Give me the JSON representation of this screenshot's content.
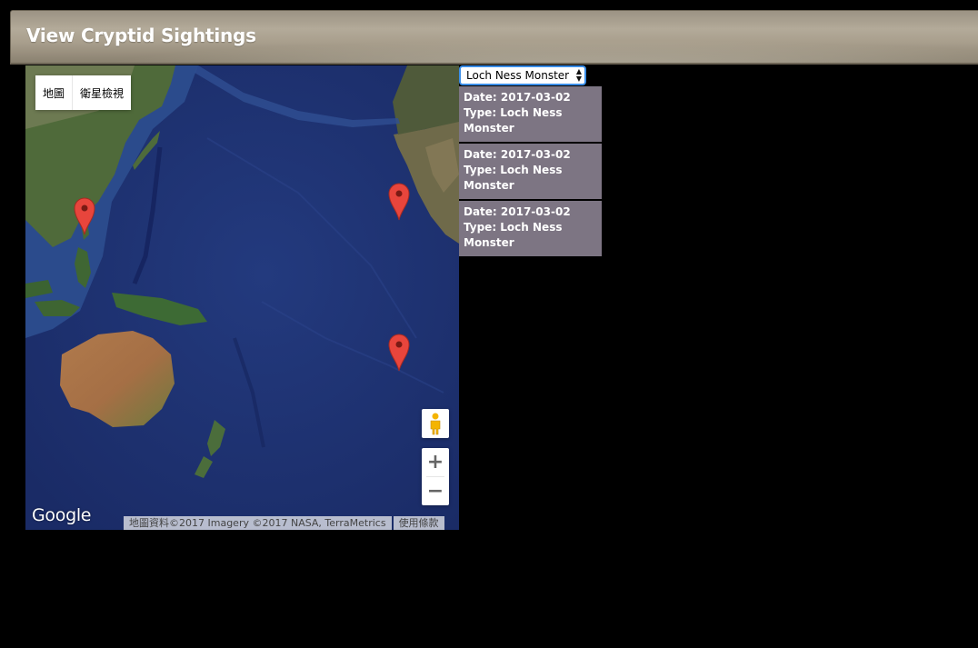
{
  "header": {
    "title": "View Cryptid Sightings"
  },
  "map": {
    "map_type_buttons": [
      "地圖",
      "衛星檢視"
    ],
    "zoom_in_label": "+",
    "zoom_out_label": "−",
    "logo_text": "Google",
    "attribution": "地圖資料©2017 Imagery ©2017 NASA, TerraMetrics",
    "terms_link": "使用條款",
    "marker_icon": "map-pin-icon",
    "pegman_icon": "street-view-pegman-icon"
  },
  "filter": {
    "selected": "Loch Ness Monster"
  },
  "sightings": [
    {
      "date_line": "Date: 2017-03-02",
      "type_line": "Type: Loch Ness Monster"
    },
    {
      "date_line": "Date: 2017-03-02",
      "type_line": "Type: Loch Ness Monster"
    },
    {
      "date_line": "Date: 2017-03-02",
      "type_line": "Type: Loch Ness Monster"
    }
  ],
  "colors": {
    "header_bg": "#a99f8d",
    "sighting_card_bg": "#7d7583",
    "ocean": "#1e3170",
    "marker": "#e8453c",
    "select_focus": "#3b8ee8"
  }
}
